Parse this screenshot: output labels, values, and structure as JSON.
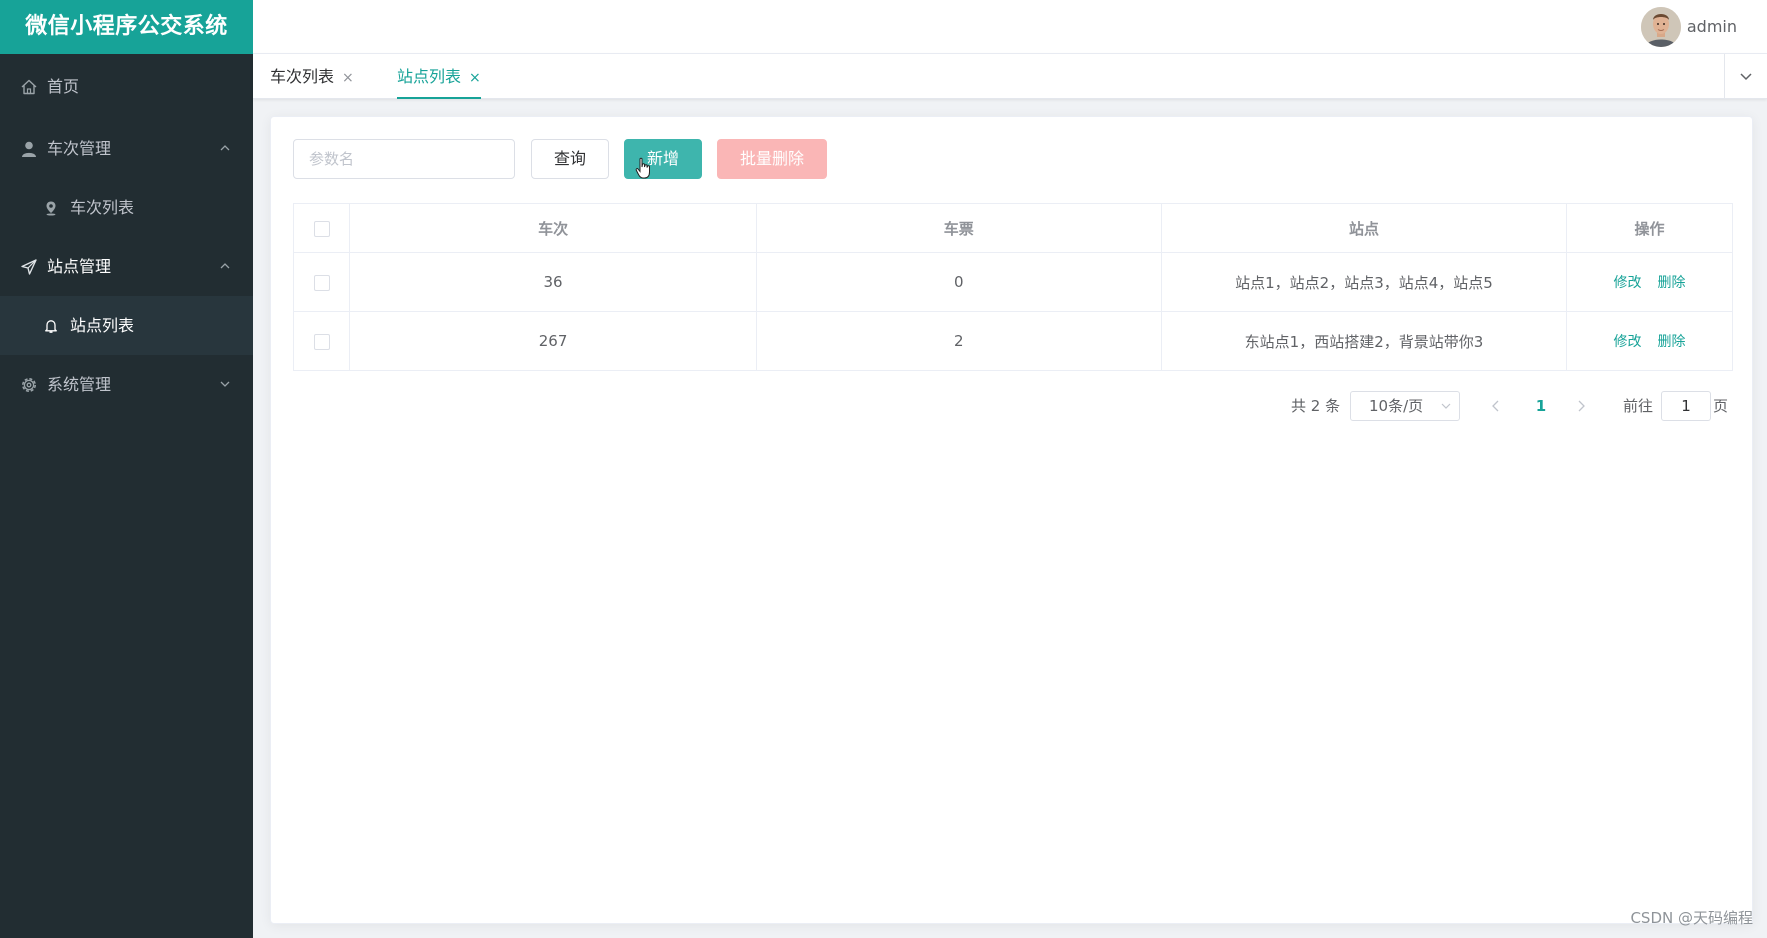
{
  "app": {
    "title": "微信小程序公交系统",
    "username": "admin"
  },
  "sidebar": {
    "items": [
      {
        "label": "首页",
        "icon": "home-icon"
      },
      {
        "label": "车次管理",
        "icon": "user-icon",
        "expanded": true,
        "children": [
          {
            "label": "车次列表",
            "icon": "location-icon"
          }
        ]
      },
      {
        "label": "站点管理",
        "icon": "send-icon",
        "expanded": true,
        "children": [
          {
            "label": "站点列表",
            "icon": "bell-icon",
            "active": true
          }
        ]
      },
      {
        "label": "系统管理",
        "icon": "gear-icon",
        "expanded": false
      }
    ]
  },
  "tabs": [
    {
      "label": "车次列表",
      "close": "×",
      "active": false
    },
    {
      "label": "站点列表",
      "close": "×",
      "active": true
    }
  ],
  "toolbar": {
    "search_placeholder": "参数名",
    "query_label": "查询",
    "add_label": "新增",
    "batch_delete_label": "批量删除"
  },
  "table": {
    "columns": [
      "车次",
      "车票",
      "站点",
      "操作"
    ],
    "rows": [
      {
        "trip": "36",
        "ticket": "0",
        "stations": "站点1，站点2，站点3，站点4，站点5"
      },
      {
        "trip": "267",
        "ticket": "2",
        "stations": "东站点1，西站搭建2，背景站带你3"
      }
    ],
    "edit_label": "修改",
    "delete_label": "删除"
  },
  "pagination": {
    "total_text": "共 2 条",
    "page_size": "10条/页",
    "current_page": "1",
    "goto_label": "前往",
    "goto_value": "1",
    "page_unit": "页"
  },
  "watermark": "CSDN @天码编程",
  "colors": {
    "accent": "#17a398",
    "sidebar_bg": "#222d32",
    "danger_light": "#fab6b6"
  }
}
